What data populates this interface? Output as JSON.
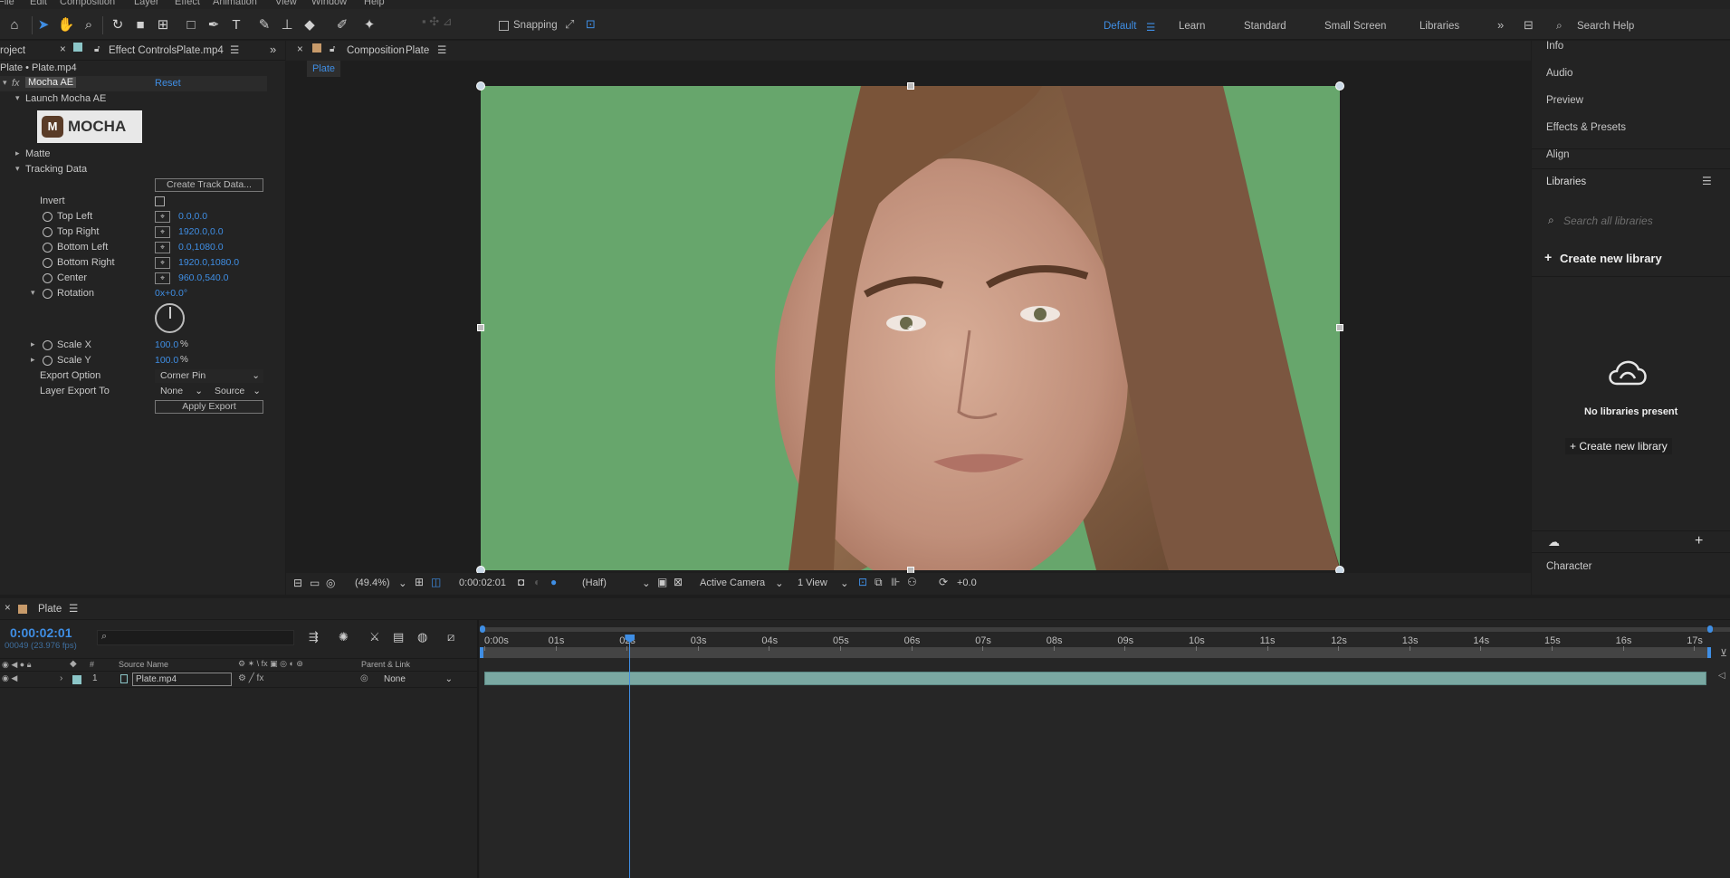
{
  "menu": [
    "File",
    "Edit",
    "Composition",
    "Layer",
    "Effect",
    "Animation",
    "View",
    "Window",
    "Help"
  ],
  "toolbar": {
    "snapping_label": "Snapping",
    "workspaces": [
      "Default",
      "Learn",
      "Standard",
      "Small Screen",
      "Libraries"
    ],
    "search_help": "Search Help"
  },
  "left_panel": {
    "project_tab": "roject",
    "effect_tab_label": "Effect Controls",
    "effect_tab_file": "Plate.mp4",
    "breadcrumb": "Plate • Plate.mp4",
    "effect_name": "Mocha AE",
    "reset": "Reset",
    "launch": "Launch Mocha AE",
    "mocha_logo": "MOCHA",
    "matte": "Matte",
    "tracking_data": "Tracking Data",
    "create_track_data": "Create Track Data...",
    "invert": "Invert",
    "top_left": "Top Left",
    "top_left_val": "0.0,0.0",
    "top_right": "Top Right",
    "top_right_val": "1920.0,0.0",
    "bottom_left": "Bottom Left",
    "bottom_left_val": "0.0,1080.0",
    "bottom_right": "Bottom Right",
    "bottom_right_val": "1920.0,1080.0",
    "center": "Center",
    "center_val": "960.0,540.0",
    "rotation": "Rotation",
    "rotation_val": "0x+0.0°",
    "scale_x": "Scale X",
    "scale_x_val": "100.0",
    "scale_y": "Scale Y",
    "scale_y_val": "100.0",
    "percent": "%",
    "export_option": "Export Option",
    "export_option_val": "Corner Pin",
    "layer_export_to": "Layer Export To",
    "layer_export_val1": "None",
    "layer_export_val2": "Source",
    "apply_export": "Apply Export"
  },
  "comp_panel": {
    "tab_label": "Composition",
    "tab_name": "Plate",
    "subtab": "Plate",
    "zoom": "(49.4%)",
    "timecode": "0:00:02:01",
    "resolution": "(Half)",
    "camera": "Active Camera",
    "view": "1 View",
    "exposure": "+0.0"
  },
  "right_panel": {
    "items": [
      "Info",
      "Audio",
      "Preview",
      "Effects & Presets",
      "Align"
    ],
    "libraries": "Libraries",
    "search_placeholder": "Search all libraries",
    "create_new": "Create new library",
    "no_libraries": "No libraries present",
    "create_new_btn": "+ Create new library",
    "character": "Character"
  },
  "timeline": {
    "tab": "Plate",
    "timecode": "0:00:02:01",
    "frames": "00049 (23.976 fps)",
    "col_source_name": "Source Name",
    "col_parent": "Parent & Link",
    "col_num": "#",
    "layer_num": "1",
    "layer_name": "Plate.mp4",
    "layer_parent": "None",
    "ruler": [
      "0:00s",
      "01s",
      "02s",
      "03s",
      "04s",
      "05s",
      "06s",
      "07s",
      "08s",
      "09s",
      "10s",
      "11s",
      "12s",
      "13s",
      "14s",
      "15s",
      "16s",
      "17s"
    ],
    "playhead_seconds": 2.04
  },
  "colors": {
    "accent": "#3f8ee4",
    "green_screen": "#65a46a",
    "layer_bar": "#7aa8a2"
  }
}
